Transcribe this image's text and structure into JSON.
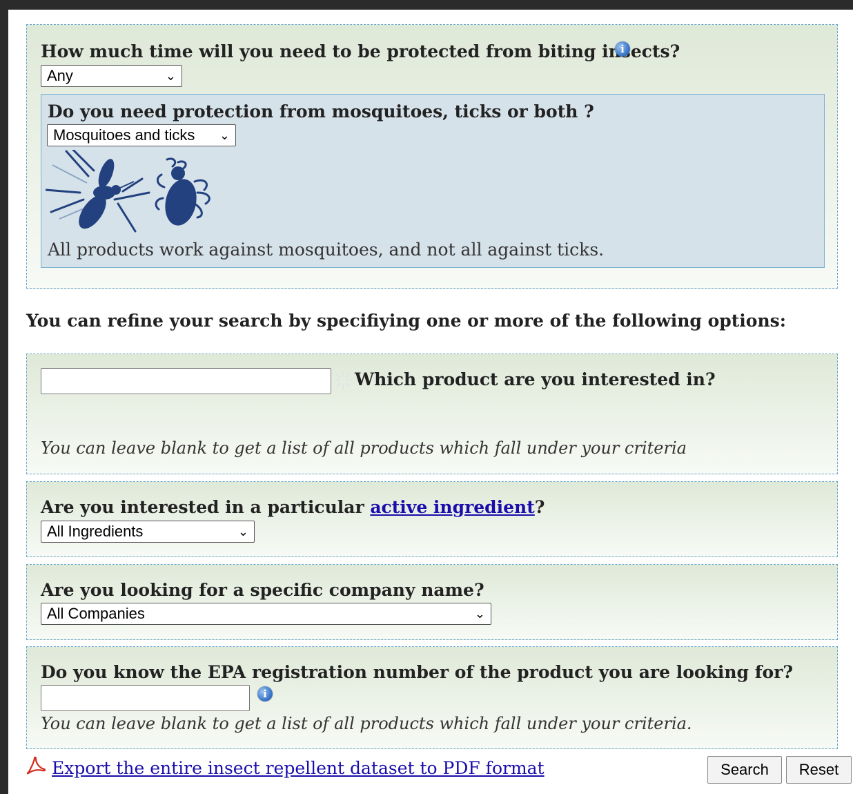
{
  "protection_time": {
    "question": "How much time will you need to be protected from biting insects?",
    "selected": "Any",
    "info_icon": "info-icon"
  },
  "pest_type": {
    "question": "Do you need protection from mosquitoes, ticks or both ?",
    "selected": "Mosquitoes and ticks",
    "icons": [
      "mosquito-icon",
      "tick-icon"
    ],
    "note": "All products work against mosquitoes, and not all against ticks."
  },
  "refine_heading": "You can refine your search by specifiying one or more of the following options:",
  "product": {
    "question": "Which product are you interested in?",
    "value": "",
    "hint": "You can leave blank to get a list of all products which fall under your criteria"
  },
  "ingredient": {
    "question_prefix": "Are you interested in a particular ",
    "link_text": "active ingredient",
    "question_suffix": "?",
    "selected": "All Ingredients"
  },
  "company": {
    "question": "Are you looking for a specific company name?",
    "selected": "All Companies"
  },
  "epa": {
    "question": "Do you know the EPA registration number of the product you are looking for?",
    "value": "",
    "hint": "You can leave blank to get a list of all products which fall under your criteria."
  },
  "export": {
    "icon": "pdf-icon",
    "link_text": "Export the entire insect repellent dataset to PDF format"
  },
  "buttons": {
    "search": "Search",
    "reset": "Reset"
  },
  "colors": {
    "panel_border": "#6aa6c8",
    "inner_box_bg": "#d6e2ea",
    "icon_blue": "#23417f",
    "link": "#1a0dab"
  }
}
